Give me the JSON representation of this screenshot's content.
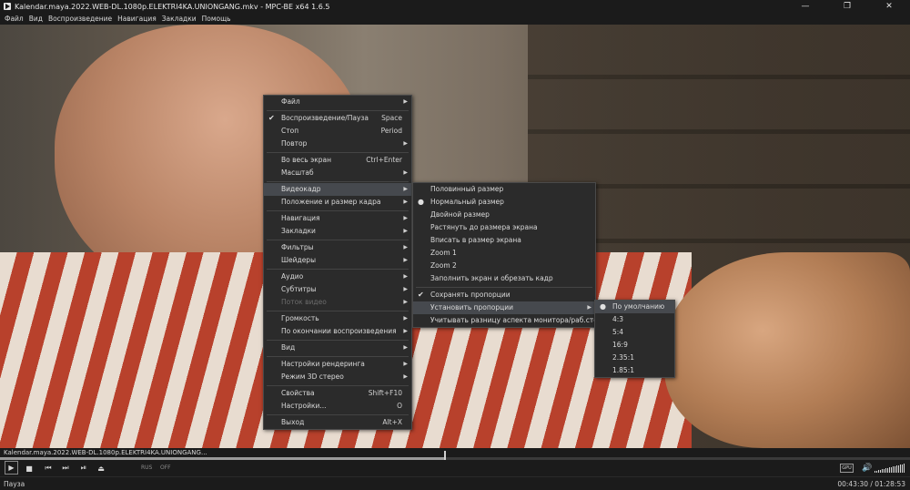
{
  "window": {
    "title": "Kalendar.maya.2022.WEB-DL.1080p.ELEKTRI4KA.UNIONGANG.mkv - MPC-BE x64 1.6.5",
    "minimize_glyph": "—",
    "maximize_glyph": "❐",
    "close_glyph": "✕"
  },
  "menubar": [
    "Файл",
    "Вид",
    "Воспроизведение",
    "Навигация",
    "Закладки",
    "Помощь"
  ],
  "context_menu": {
    "items": [
      {
        "type": "item",
        "label": "Файл",
        "submenu": true
      },
      {
        "type": "sep"
      },
      {
        "type": "item",
        "label": "Воспроизведение/Пауза",
        "shortcut": "Space",
        "checked": true
      },
      {
        "type": "item",
        "label": "Стоп",
        "shortcut": "Period"
      },
      {
        "type": "item",
        "label": "Повтор",
        "submenu": true
      },
      {
        "type": "sep"
      },
      {
        "type": "item",
        "label": "Во весь экран",
        "shortcut": "Ctrl+Enter"
      },
      {
        "type": "item",
        "label": "Масштаб",
        "submenu": true
      },
      {
        "type": "sep"
      },
      {
        "type": "item",
        "label": "Видеокадр",
        "submenu": true,
        "highlighted": true
      },
      {
        "type": "item",
        "label": "Положение и размер кадра",
        "submenu": true
      },
      {
        "type": "sep"
      },
      {
        "type": "item",
        "label": "Навигация",
        "submenu": true
      },
      {
        "type": "item",
        "label": "Закладки",
        "submenu": true
      },
      {
        "type": "sep"
      },
      {
        "type": "item",
        "label": "Фильтры",
        "submenu": true
      },
      {
        "type": "item",
        "label": "Шейдеры",
        "submenu": true
      },
      {
        "type": "sep"
      },
      {
        "type": "item",
        "label": "Аудио",
        "submenu": true
      },
      {
        "type": "item",
        "label": "Субтитры",
        "submenu": true
      },
      {
        "type": "item",
        "label": "Поток видео",
        "submenu": true,
        "disabled": true
      },
      {
        "type": "sep"
      },
      {
        "type": "item",
        "label": "Громкость",
        "submenu": true
      },
      {
        "type": "item",
        "label": "По окончании воспроизведения",
        "submenu": true
      },
      {
        "type": "sep"
      },
      {
        "type": "item",
        "label": "Вид",
        "submenu": true
      },
      {
        "type": "sep"
      },
      {
        "type": "item",
        "label": "Настройки рендеринга",
        "submenu": true
      },
      {
        "type": "item",
        "label": "Режим 3D стерео",
        "submenu": true
      },
      {
        "type": "sep"
      },
      {
        "type": "item",
        "label": "Свойства",
        "shortcut": "Shift+F10"
      },
      {
        "type": "item",
        "label": "Настройки...",
        "shortcut": "O"
      },
      {
        "type": "sep"
      },
      {
        "type": "item",
        "label": "Выход",
        "shortcut": "Alt+X"
      }
    ]
  },
  "video_frame_menu": {
    "items": [
      {
        "type": "item",
        "label": "Половинный размер"
      },
      {
        "type": "item",
        "label": "Нормальный размер",
        "radio": true
      },
      {
        "type": "item",
        "label": "Двойной размер"
      },
      {
        "type": "item",
        "label": "Растянуть до размера экрана"
      },
      {
        "type": "item",
        "label": "Вписать в размер экрана"
      },
      {
        "type": "item",
        "label": "Zoom 1"
      },
      {
        "type": "item",
        "label": "Zoom 2"
      },
      {
        "type": "item",
        "label": "Заполнить экран и обрезать кадр"
      },
      {
        "type": "sep"
      },
      {
        "type": "item",
        "label": "Сохранять пропорции",
        "checked": true
      },
      {
        "type": "item",
        "label": "Установить пропорции",
        "submenu": true,
        "highlighted": true
      },
      {
        "type": "item",
        "label": "Учитывать разницу аспекта монитора/раб.стола"
      }
    ]
  },
  "aspect_menu": {
    "items": [
      {
        "type": "item",
        "label": "По умолчанию",
        "radio": true,
        "highlighted": true
      },
      {
        "type": "item",
        "label": "4:3"
      },
      {
        "type": "item",
        "label": "5:4"
      },
      {
        "type": "item",
        "label": "16:9"
      },
      {
        "type": "item",
        "label": "2.35:1"
      },
      {
        "type": "item",
        "label": "1.85:1"
      }
    ]
  },
  "player": {
    "filename": "Kalendar.maya.2022.WEB-DL.1080p.ELEKTRI4KA.UNIONGANG...",
    "audio_lang_label": "RUS",
    "subtitle_label": "OFF",
    "gpu_label": "GPU",
    "status": "Пауза",
    "time": "00:43:30 / 01:28:53",
    "progress_fraction": 0.4894,
    "volume_fraction": 1.0
  },
  "glyphs": {
    "check": "✔",
    "radio": "●",
    "submenu_arrow": "▶",
    "play": "▶",
    "stop": "■",
    "prev": "⏮",
    "next": "⏭",
    "frame_step": "⏯",
    "eject": "⏏",
    "speaker": "🔊"
  }
}
